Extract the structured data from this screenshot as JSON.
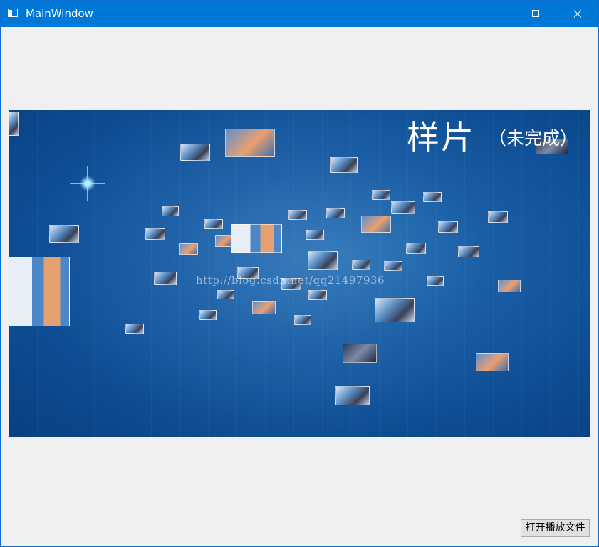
{
  "window": {
    "title": "MainWindow",
    "controls": [
      "minimize-icon",
      "maximize-icon",
      "close-icon"
    ]
  },
  "video": {
    "title": "样片",
    "subtitle": "（未完成）",
    "watermark": "http://blog.csdn.net/qq21497936"
  },
  "toolbar": {
    "open_file_label": "打开播放文件"
  },
  "colors": {
    "titlebar": "#0078d7",
    "window_bg": "#f0f0f0",
    "video_bg": "#1a5ea6"
  }
}
